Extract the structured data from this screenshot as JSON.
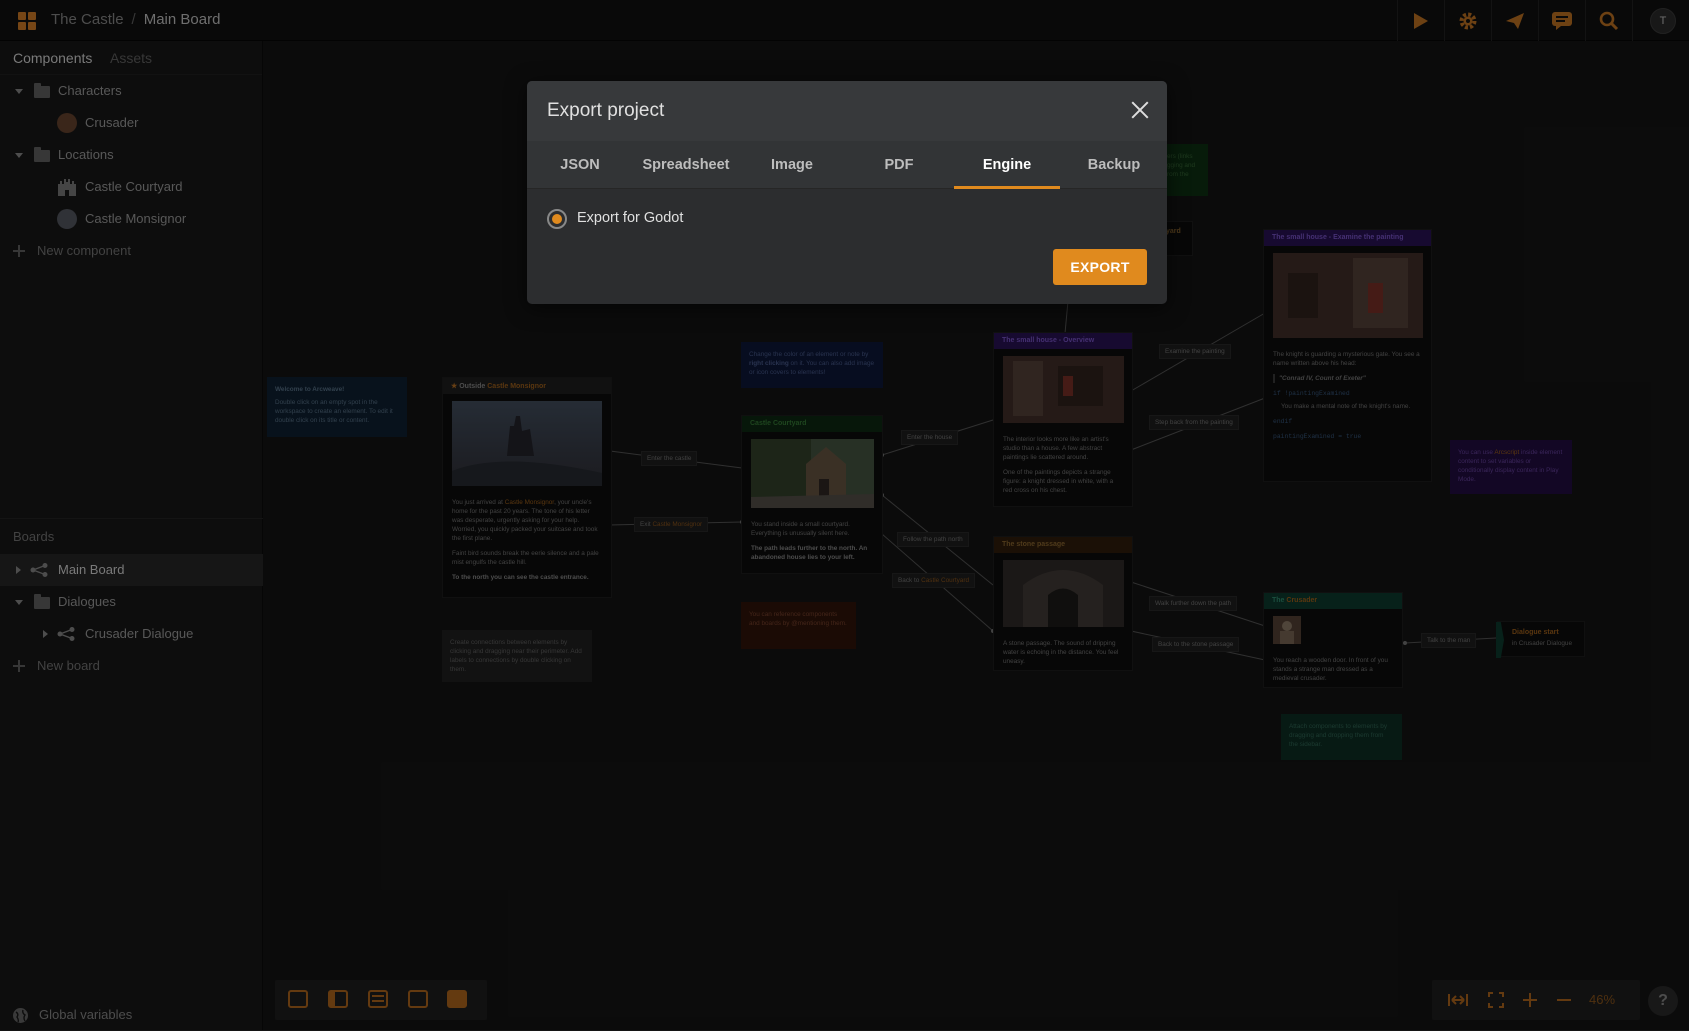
{
  "topbar": {
    "project": "The Castle",
    "separator": "/",
    "board": "Main Board",
    "avatar_initial": "T"
  },
  "sidebar": {
    "tabs": [
      "Components",
      "Assets"
    ],
    "components": [
      {
        "label": "Characters",
        "type": "folder"
      },
      {
        "label": "Crusader",
        "type": "component"
      },
      {
        "label": "Locations",
        "type": "folder"
      },
      {
        "label": "Castle Courtyard",
        "type": "component"
      },
      {
        "label": "Castle Monsignor",
        "type": "component"
      }
    ],
    "new_component": "New component",
    "boards_heading": "Boards",
    "boards": [
      {
        "label": "Main Board",
        "type": "board"
      },
      {
        "label": "Dialogues",
        "type": "folder"
      },
      {
        "label": "Crusader Dialogue",
        "type": "board"
      }
    ],
    "new_board": "New board",
    "global_variables": "Global variables"
  },
  "canvas": {
    "welcome": {
      "title": "Welcome to Arcweave!",
      "body": "Double click on an empty spot in the workspace to create an element. To edit it double click on its title or content."
    },
    "outside_title": "Outside ",
    "outside_ref": "Castle Monsignor",
    "outside_body1a": "You just arrived at ",
    "outside_body1b": "Castle Monsignor",
    "outside_body1c": ", your uncle's home for the past 20 years. The tone of his letter was desperate, urgently asking for your help. Worried, you quickly packed your suitcase and took the first plane.",
    "outside_body2": "Faint bird sounds break the eerie silence and a pale mist engulfs the castle hill.",
    "outside_body3": "To the north you can see the castle entrance.",
    "connections_note": "Create connections between elements by clicking and dragging near their perimeter. Add labels to connections by double clicking on them.",
    "color_note_a": "Change the color of an element or note by ",
    "color_note_b": "right clicking",
    "color_note_c": " on it. You can also add image or icon covers to elements!",
    "courtyard_title": "Castle Courtyard",
    "courtyard_body1": "You stand inside a small courtyard. Everything is unusually silent here.",
    "courtyard_body2": "The path leads further to the north. An abandoned house lies to your left.",
    "reference_note": "You can reference components and boards by @mentioning them.",
    "house_title": "The small house - Overview",
    "house_body1": "The interior looks more like an artist's studio than a house. A few abstract paintings lie scattered around.",
    "house_body2": "One of the paintings depicts a strange figure: a knight dressed in white, with a red cross on his chest.",
    "passage_title": "The stone passage",
    "passage_body": "A stone passage. The sound of dripping water is echoing in the distance. You feel uneasy.",
    "painting_title": "The small house - Examine the painting",
    "painting_body1": "The knight is guarding a mysterious gate. You see a name written above his head:",
    "painting_quote": "\"Conrad IV, Count of Exeter\"",
    "painting_if": "if !paintingExamined",
    "painting_note": "You make a mental note of the knight's name.",
    "painting_endif": "endif",
    "painting_assign": "paintingExamined = true",
    "arcscript_note_a": "You can use ",
    "arcscript_note_b": "Arcscript",
    "arcscript_note_c": " inside element content to set variables or conditionally display content in Play Mode.",
    "crusader_title_a": "The ",
    "crusader_title_b": "Crusader",
    "crusader_body": "You reach a wooden door. In front of you stands a strange man dressed as a medieval crusader.",
    "dialogue_title": "Dialogue start",
    "dialogue_sub": "in Crusader Dialogue",
    "attach_note": "Attach components to elements by dragging and dropping them from the sidebar.",
    "partial_green": "ers (links gging and rom the",
    "partial_yard": "yard",
    "labels": {
      "enter_castle": "Enter the castle",
      "exit": "Exit ",
      "exit_ref": "Castle Monsignor",
      "enter_house": "Enter the house",
      "follow_path": "Follow the path north",
      "back_to": "Back to ",
      "back_ref": "Castle Courtyard",
      "examine": "Examine the painting",
      "step_back": "Step back from the painting",
      "walk_further": "Walk further down the path",
      "back_passage": "Back to the stone passage",
      "talk": "Talk to the man"
    }
  },
  "zoom": {
    "level": "46%"
  },
  "help": "?",
  "modal": {
    "title": "Export project",
    "tabs": [
      "JSON",
      "Spreadsheet",
      "Image",
      "PDF",
      "Engine",
      "Backup"
    ],
    "active_tab": "Engine",
    "option_label": "Export for Godot",
    "export_button": "EXPORT"
  },
  "colors": {
    "accent": "#e08a1e",
    "modal_bg": "#2c2d2f",
    "canvas_bg": "#121212"
  }
}
